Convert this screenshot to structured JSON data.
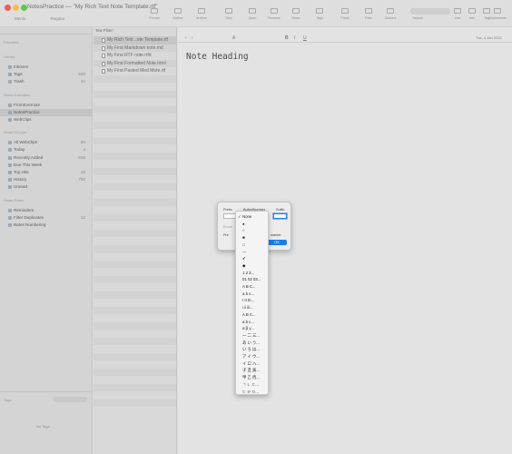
{
  "window": {
    "title": "NotesPractice — \"My Rich Text Note Template.rtf\""
  },
  "toolbar": {
    "font_label": "Menlo",
    "weight_label": "Regular",
    "buttons": [
      "Format",
      "Outline",
      "Archive",
      "New",
      "Open",
      "Rename",
      "Move",
      "Tags",
      "Paste",
      "Filter",
      "Outdent",
      "Search",
      "Link",
      "Info",
      "Tag",
      "Attachments"
    ]
  },
  "sidebar": {
    "sections": [
      {
        "header": "Favorites",
        "items": []
      },
      {
        "header": "Library",
        "items": [
          {
            "label": "Inboxes",
            "count": ""
          },
          {
            "label": "Tags",
            "count": "520"
          },
          {
            "label": "Trash",
            "count": "34"
          }
        ]
      },
      {
        "header": "Notes Examples",
        "items": [
          {
            "label": "FromEvernote",
            "count": ""
          },
          {
            "label": "NotesPractice",
            "count": ""
          },
          {
            "label": "WebClips",
            "count": ""
          }
        ]
      },
      {
        "header": "Smart Groups",
        "items": [
          {
            "label": "All WebClips",
            "count": "90"
          },
          {
            "label": "Today",
            "count": "4"
          },
          {
            "label": "Recently Added",
            "count": "639"
          },
          {
            "label": "Due This Week",
            "count": ""
          },
          {
            "label": "Top Hits",
            "count": "18"
          },
          {
            "label": "History",
            "count": "750"
          },
          {
            "label": "Unread",
            "count": ""
          }
        ]
      },
      {
        "header": "Smart Rules",
        "items": [
          {
            "label": "Reminders",
            "count": ""
          },
          {
            "label": "Filter Duplicates",
            "count": "13"
          },
          {
            "label": "Bates Numbering",
            "count": ""
          }
        ]
      }
    ],
    "tags_label": "Tags",
    "no_tags_label": "No Tags"
  },
  "notelist": {
    "filter_label": "Tea Filter:",
    "items": [
      {
        "name": "My Rich Text...ote Template.rtf",
        "selected": true
      },
      {
        "name": "My First Markdown note.md",
        "selected": false
      },
      {
        "name": "My First RTF note.rtfd",
        "selected": false
      },
      {
        "name": "My First Formatted Note.html",
        "selected": false
      },
      {
        "name": "My First Pasted Med Mote.rtf",
        "selected": false
      }
    ]
  },
  "editor": {
    "heading": "Note Heading",
    "date_label": "Tue, 4 Jan 2022"
  },
  "dialog": {
    "prefix_label": "Prefix",
    "bullet_label": "Bullet/Number",
    "suffix_label": "Suffix",
    "ok_label": "OK",
    "marker_label": "marker",
    "enumerate_label": "Enum",
    "pre_label": "Pre"
  },
  "dropdown": {
    "selected": "None",
    "items": [
      "None",
      "●",
      "○",
      "■",
      "□",
      "—",
      "✔",
      "◆",
      "1 2 3...",
      "01 02 03...",
      "A B C...",
      "a b c...",
      "I II III...",
      "i ii iii...",
      "A B C...",
      "a b c...",
      "α β γ...",
      "一 二 三...",
      "あ い う...",
      "い ろ は...",
      "ア イ ウ...",
      "イ ロ ハ...",
      "子 丑 寅...",
      "甲 乙 丙...",
      "ㄱ ㄴ ㄷ...",
      "ㄷ ㄹ ㅁ..."
    ]
  },
  "colors": {
    "close": "#ec5f57",
    "minimize": "#f3be4f",
    "zoom": "#5fc454",
    "accent": "#1b7cf2"
  }
}
